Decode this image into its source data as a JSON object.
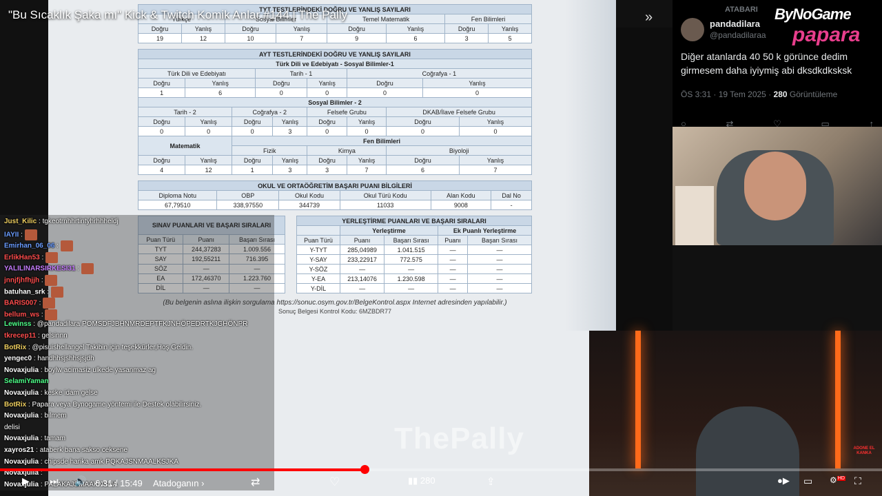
{
  "video": {
    "title": "\"Bu Sıcaklık Şaka mı\" Kick & Twitch Komik Anlar #144 | The Pally",
    "time_current": "6:31",
    "time_total": "15:49",
    "time_separator": " / ",
    "chapter": "Atadoganın ›",
    "progress_fraction": 0.413,
    "watermark": "ThePally"
  },
  "doc": {
    "tyt_header_partial": "TYT TESTLERİNDEKİ DOĞRU VE YANLIŞ SAYILARI",
    "tyt_subjects": [
      "Türkçe",
      "Sosyal Bilimler",
      "Temel Matematik",
      "Fen Bilimleri"
    ],
    "col_dogru": "Doğru",
    "col_yanlis": "Yanlış",
    "tyt_values": [
      "19",
      "12",
      "10",
      "7",
      "9",
      "6",
      "3",
      "5"
    ],
    "ayt_header": "AYT TESTLERİNDEKİ DOĞRU VE YANLIŞ SAYILARI",
    "ayt_group1": "Türk Dili ve Edebiyatı - Sosyal Bilimler-1",
    "ayt_g1_subjects": [
      "Türk Dili ve Edebiyatı",
      "Tarih - 1",
      "Coğrafya - 1"
    ],
    "ayt_g1_values": [
      "1",
      "6",
      "0",
      "0",
      "0",
      "0"
    ],
    "ayt_group2": "Sosyal Bilimler - 2",
    "ayt_g2_subjects": [
      "Tarih - 2",
      "Coğrafya - 2",
      "Felsefe Grubu",
      "DKAB/İlave Felsefe Grubu"
    ],
    "ayt_g2_values": [
      "0",
      "0",
      "0",
      "3",
      "0",
      "0",
      "0",
      "0"
    ],
    "ayt_math": "Matematik",
    "ayt_fen": "Fen Bilimleri",
    "ayt_fen_subjects": [
      "Fizik",
      "Kimya",
      "Biyoloji"
    ],
    "ayt_g3_values": [
      "4",
      "12",
      "1",
      "3",
      "3",
      "7",
      "6",
      "7"
    ],
    "okul_header": "OKUL VE ORTAÖĞRETİM BAŞARI PUANI BİLGİLERİ",
    "okul_cols": [
      "Diploma Notu",
      "OBP",
      "Okul Kodu",
      "Okul Türü Kodu",
      "Alan Kodu",
      "Dal No"
    ],
    "okul_values": [
      "67,79510",
      "338,97550",
      "344739",
      "11033",
      "9008",
      "-"
    ],
    "sinav_header": "SINAV PUANLARI VE BAŞARI SIRALARI",
    "sinav_cols": [
      "Puan Türü",
      "Puanı",
      "Başarı Sırası"
    ],
    "sinav_rows": [
      [
        "TYT",
        "244,37283",
        "1.009.556"
      ],
      [
        "SAY",
        "192,55211",
        "716.395"
      ],
      [
        "SÖZ",
        "—",
        "—"
      ],
      [
        "EA",
        "172,46370",
        "1.223.760"
      ],
      [
        "DİL",
        "—",
        "—"
      ]
    ],
    "yer_header": "YERLEŞTİRME PUANLARI VE BAŞARI SIRALARI",
    "yer_sub1": "Yerleştirme",
    "yer_sub2": "Ek Puanlı Yerleştirme",
    "yer_cols": [
      "Puan Türü",
      "Puanı",
      "Başarı Sırası",
      "Puanı",
      "Başarı Sırası"
    ],
    "yer_rows": [
      [
        "Y-TYT",
        "285,04989",
        "1.041.515",
        "—",
        "—"
      ],
      [
        "Y-SAY",
        "233,22917",
        "772.575",
        "—",
        "—"
      ],
      [
        "Y-SÖZ",
        "—",
        "—",
        "—",
        "—"
      ],
      [
        "Y-EA",
        "213,14076",
        "1.230.598",
        "—",
        "—"
      ],
      [
        "Y-DİL",
        "—",
        "—",
        "—",
        "—"
      ]
    ],
    "note": "(Bu belgenin aslına ilişkin sorgulama https://sonuc.osym.gov.tr/BelgeKontrol.aspx Internet adresinden yapılabilir.)",
    "code": "Sonuç Belgesi Kontrol Kodu: 6MZBDR77"
  },
  "tweet": {
    "retweet_label": "ATABARI",
    "name": "pandadilara",
    "handle": "@pandadilaraa",
    "text": "Diğer atanlarda 40 50 k görünce dedim girmesem daha iyiymiş abi dksdkdksksk",
    "time": "ÖS 3:31 · 19 Tem 2025 · ",
    "views_count": "280",
    "views_label": " Görüntüleme",
    "action_icons": [
      "reply-icon",
      "retweet-icon",
      "like-icon",
      "bookmark-icon",
      "share-icon"
    ]
  },
  "brand": {
    "bynogame": "ByNoGame",
    "papara": "papara"
  },
  "cam_badge": "ADONE EL KANKA",
  "chat": [
    {
      "user": "Just_Kilic",
      "color": "#f0d060",
      "text": ": tgkeotrnhhrtintyhrhhheldj"
    },
    {
      "user": "IAYII",
      "color": "#6a9cff",
      "text": ":",
      "emote": true
    },
    {
      "user": "Emirhan_06_06",
      "color": "#6a9cff",
      "text": ":",
      "emote": true
    },
    {
      "user": "ErlikHan53",
      "color": "#ff4d4d",
      "text": ":",
      "emote": true
    },
    {
      "user": "YALILINARSIRKESI31",
      "color": "#c77dff",
      "text": ":",
      "emote": true
    },
    {
      "user": "jnnjfjhfhjjh",
      "color": "#ff4d4d",
      "text": ":",
      "emote": true
    },
    {
      "user": "batuhan_srk",
      "color": "#ffffff",
      "text": ":",
      "emote": true
    },
    {
      "user": "BARIS007",
      "color": "#ff4d4d",
      "text": ":",
      "emote": true
    },
    {
      "user": "bellum_ws",
      "color": "#ff4d4d",
      "text": ":",
      "emote": true
    },
    {
      "user": "Lewinss",
      "color": "#4dff88",
      "text": ": @pandadilara POMSDFJBHNMRDEPTFKJNHÖPEDRTKJGHÖNPR"
    },
    {
      "user": "tkrecep11",
      "color": "#ff4d4d",
      "text": ": gelsinnn"
    },
    {
      "user": "BotRix",
      "color": "#f0d060",
      "text": ": @pisuishellangel Takibin için teşekkürler,Hoş Geldin."
    },
    {
      "user": "yengec0",
      "color": "#ffffff",
      "text": ": handhhsjshhsjsjdh"
    },
    {
      "user": "Novaxjulia",
      "color": "#ffffff",
      "text": ": boylw acimasiz ulkede yasanmaz ag"
    },
    {
      "user": "SelamiYaman",
      "color": "#4dff88",
      "text": ""
    },
    {
      "user": "Novaxjulia",
      "color": "#ffffff",
      "text": ": keske idam gelse"
    },
    {
      "user": "BotRix",
      "color": "#f0d060",
      "text": ": Papara veya Bynogame yöntemi ile Destek olabilirsiniz."
    },
    {
      "user": "Novaxjulia",
      "color": "#ffffff",
      "text": ": bilmem"
    },
    {
      "user": "",
      "color": "#ffffff",
      "text": "delisi"
    },
    {
      "user": "Novaxjulia",
      "color": "#ffffff",
      "text": ": tamam"
    },
    {
      "user": "xayros21",
      "color": "#ffffff",
      "text": ": ataberk bana sakso ceksene"
    },
    {
      "user": "Novaxjulia",
      "color": "#ffffff",
      "text": ": chipsde harika amk PQKAJSNMAALKSJKA"
    },
    {
      "user": "Novaxjulia",
      "color": "#ffffff",
      "text": ":"
    },
    {
      "user": "Novaxjulia",
      "color": "#ffffff",
      "text": ": PALAKAJSMAAKNSNA"
    }
  ],
  "controls": {
    "like_count": "280",
    "hd_badge": "HD"
  }
}
